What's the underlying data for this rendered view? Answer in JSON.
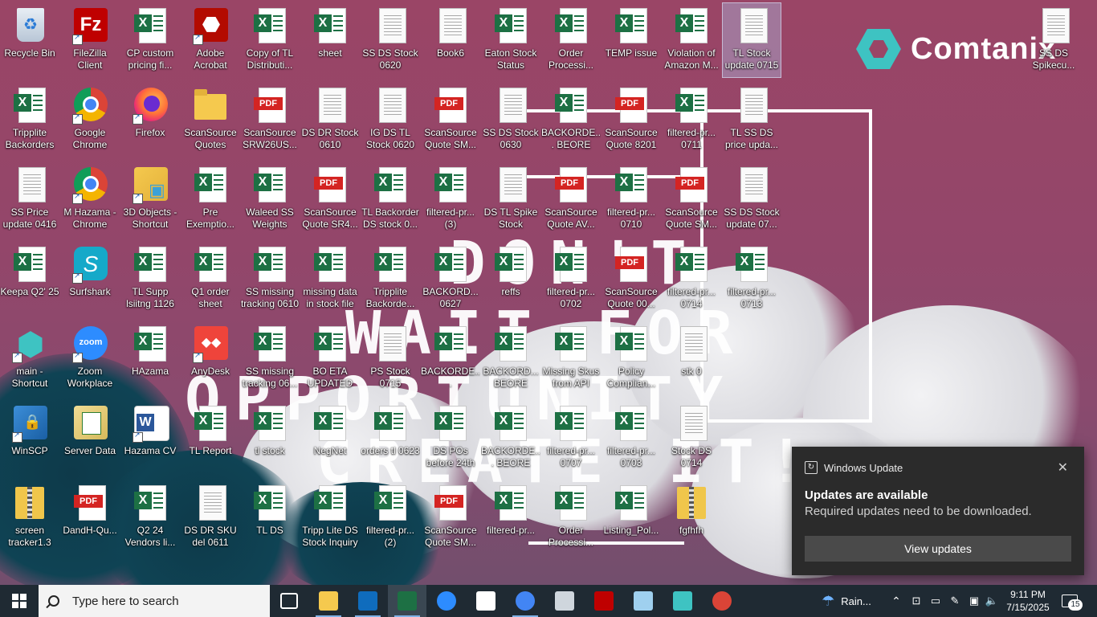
{
  "wallpaper": {
    "brand": "Comtanix",
    "quote_lines": [
      "DON'T",
      "WAIT FOR",
      "OPPORTUNITY",
      "CREATE IT!"
    ]
  },
  "desktop_icons": [
    {
      "label": "Recycle Bin",
      "type": "bin"
    },
    {
      "label": "FileZilla Client",
      "type": "filezilla",
      "shortcut": true
    },
    {
      "label": "CP custom pricing fi...",
      "type": "xlsx"
    },
    {
      "label": "Adobe Acrobat",
      "type": "acrobat",
      "shortcut": true
    },
    {
      "label": "Copy of TL Distributi...",
      "type": "xlsx"
    },
    {
      "label": "sheet",
      "type": "xlsx"
    },
    {
      "label": "SS DS Stock 0620",
      "type": "txt"
    },
    {
      "label": "Book6",
      "type": "txt"
    },
    {
      "label": "Eaton Stock Status",
      "type": "xlsx"
    },
    {
      "label": "Order Processi...",
      "type": "xlsx"
    },
    {
      "label": "TEMP issue",
      "type": "xlsx"
    },
    {
      "label": "Violation of Amazon M...",
      "type": "xlsx"
    },
    {
      "label": "TL Stock update 0715",
      "type": "txt",
      "selected": true
    },
    {
      "label": "SS DS Spikecu...",
      "type": "txt"
    },
    {
      "label": "Tripplite Backorders",
      "type": "xlsx"
    },
    {
      "label": "Google Chrome",
      "type": "chrome",
      "shortcut": true
    },
    {
      "label": "Firefox",
      "type": "firefox",
      "shortcut": true
    },
    {
      "label": "ScanSource Quotes",
      "type": "folder"
    },
    {
      "label": "ScanSource SRW26US...",
      "type": "pdf"
    },
    {
      "label": "DS DR Stock 0610",
      "type": "txt"
    },
    {
      "label": "IG DS TL Stock 0620",
      "type": "txt"
    },
    {
      "label": "ScanSource Quote SM...",
      "type": "pdf"
    },
    {
      "label": "SS DS Stock 0630",
      "type": "txt"
    },
    {
      "label": "BACKORDE... BEORE 23R...",
      "type": "xlsx"
    },
    {
      "label": "ScanSource Quote 8201",
      "type": "pdf"
    },
    {
      "label": "filtered-pr... 0711",
      "type": "xlsx"
    },
    {
      "label": "TL SS DS price upda...",
      "type": "txt"
    },
    {
      "label": "SS Price update 0416",
      "type": "txt"
    },
    {
      "label": "M Hazama - Chrome",
      "type": "chrome",
      "shortcut": true
    },
    {
      "label": "3D Objects - Shortcut",
      "type": "3d",
      "shortcut": true
    },
    {
      "label": "Pre Exemptio...",
      "type": "xlsx"
    },
    {
      "label": "Waleed SS Weights",
      "type": "xlsx"
    },
    {
      "label": "ScanSource Quote SR4...",
      "type": "pdf"
    },
    {
      "label": "TL Backorder DS stock 0...",
      "type": "xlsx"
    },
    {
      "label": "filtered-pr... (3)",
      "type": "xlsx"
    },
    {
      "label": "DS TL Spike Stock",
      "type": "txt"
    },
    {
      "label": "ScanSource Quote AV...",
      "type": "pdf"
    },
    {
      "label": "filtered-pr... 0710",
      "type": "xlsx"
    },
    {
      "label": "ScanSource Quote SM...",
      "type": "pdf"
    },
    {
      "label": "SS DS Stock update 07...",
      "type": "txt"
    },
    {
      "label": "Keepa Q2' 25",
      "type": "xlsx"
    },
    {
      "label": "Surfshark",
      "type": "surf",
      "shortcut": true
    },
    {
      "label": "TL Supp lsiitng 1126",
      "type": "xlsx"
    },
    {
      "label": "Q1 order sheet",
      "type": "xlsx"
    },
    {
      "label": "SS missing tracking 0610",
      "type": "xlsx"
    },
    {
      "label": "missing data in stock file",
      "type": "xlsx"
    },
    {
      "label": "Tripplite Backorde...",
      "type": "xlsx"
    },
    {
      "label": "BACKORD... 0627",
      "type": "xlsx"
    },
    {
      "label": "reffs",
      "type": "xlsx"
    },
    {
      "label": "filtered-pr... 0702",
      "type": "xlsx"
    },
    {
      "label": "ScanSource Quote 00...",
      "type": "pdf"
    },
    {
      "label": "filtered-pr... 0714",
      "type": "xlsx"
    },
    {
      "label": "filtered-pr... 0713",
      "type": "xlsx"
    },
    {
      "label": "main - Shortcut",
      "type": "main",
      "shortcut": true
    },
    {
      "label": "Zoom Workplace",
      "type": "zoom",
      "shortcut": true
    },
    {
      "label": "HAzama",
      "type": "xlsx"
    },
    {
      "label": "AnyDesk",
      "type": "anydesk",
      "shortcut": true
    },
    {
      "label": "SS missing tracking 06...",
      "type": "xlsx"
    },
    {
      "label": "BO ETA UPDATED",
      "type": "xlsx"
    },
    {
      "label": "PS Stock 0715",
      "type": "txt"
    },
    {
      "label": "BACKORDE... 0627(20250...",
      "type": "xlsx"
    },
    {
      "label": "BACKORD... BEORE 23R...",
      "type": "xlsx"
    },
    {
      "label": "Missing Skus from API",
      "type": "xlsx"
    },
    {
      "label": "Policy Complian...",
      "type": "xlsx"
    },
    {
      "label": "stk 0",
      "type": "txt"
    },
    {
      "label": "WinSCP",
      "type": "winscp",
      "shortcut": true
    },
    {
      "label": "Server Data",
      "type": "server"
    },
    {
      "label": "Hazama CV",
      "type": "word",
      "shortcut": true
    },
    {
      "label": "TL Report",
      "type": "xlsx"
    },
    {
      "label": "tl stock",
      "type": "xlsx"
    },
    {
      "label": "NegNet",
      "type": "xlsx"
    },
    {
      "label": "orders tl 0623",
      "type": "xlsx"
    },
    {
      "label": "DS POs before 24th",
      "type": "xlsx"
    },
    {
      "label": "BACKORDE... BEORE 23R...",
      "type": "xlsx"
    },
    {
      "label": "filtered-pr... 0707",
      "type": "xlsx"
    },
    {
      "label": "filtered-pr... 0703",
      "type": "xlsx"
    },
    {
      "label": "Stock DS 0714",
      "type": "txt"
    },
    {
      "label": "screen tracker1.3",
      "type": "zip"
    },
    {
      "label": "DandH-Qu...",
      "type": "pdf"
    },
    {
      "label": "Q2 24 Vendors li...",
      "type": "xlsx"
    },
    {
      "label": "DS DR SKU del 0611",
      "type": "txt"
    },
    {
      "label": "TL DS",
      "type": "xlsx"
    },
    {
      "label": "Tripp Lite DS Stock Inquiry",
      "type": "xlsx"
    },
    {
      "label": "filtered-pr... (2)",
      "type": "xlsx"
    },
    {
      "label": "ScanSource Quote SM...",
      "type": "pdf"
    },
    {
      "label": "filtered-pr...",
      "type": "xlsx"
    },
    {
      "label": "Order Processi...",
      "type": "xlsx"
    },
    {
      "label": "Listing_Pol...",
      "type": "xlsx"
    },
    {
      "label": "fgfhfh",
      "type": "zip"
    }
  ],
  "notification": {
    "app": "Windows Update",
    "title": "Updates are available",
    "message": "Required updates need to be downloaded.",
    "button": "View updates"
  },
  "taskbar": {
    "search_placeholder": "Type here to search",
    "apps": [
      {
        "name": "task-view",
        "color": "#ffffff"
      },
      {
        "name": "file-explorer",
        "color": "#f5c94e"
      },
      {
        "name": "outlook",
        "color": "#0f6cbd"
      },
      {
        "name": "excel",
        "color": "#1d7044"
      },
      {
        "name": "zoom",
        "color": "#2d8cff"
      },
      {
        "name": "paint",
        "color": "#ffffff"
      },
      {
        "name": "chrome-profile",
        "color": "#4285f4"
      },
      {
        "name": "calculator",
        "color": "#cfd6dd"
      },
      {
        "name": "filezilla",
        "color": "#bf0000"
      },
      {
        "name": "notepad",
        "color": "#9fd0ef"
      },
      {
        "name": "main-app",
        "color": "#3ec3c2"
      },
      {
        "name": "chrome",
        "color": "#db4437"
      }
    ],
    "weather": "Rain...",
    "time": "9:11 PM",
    "date": "7/15/2025",
    "notification_count": "15"
  }
}
